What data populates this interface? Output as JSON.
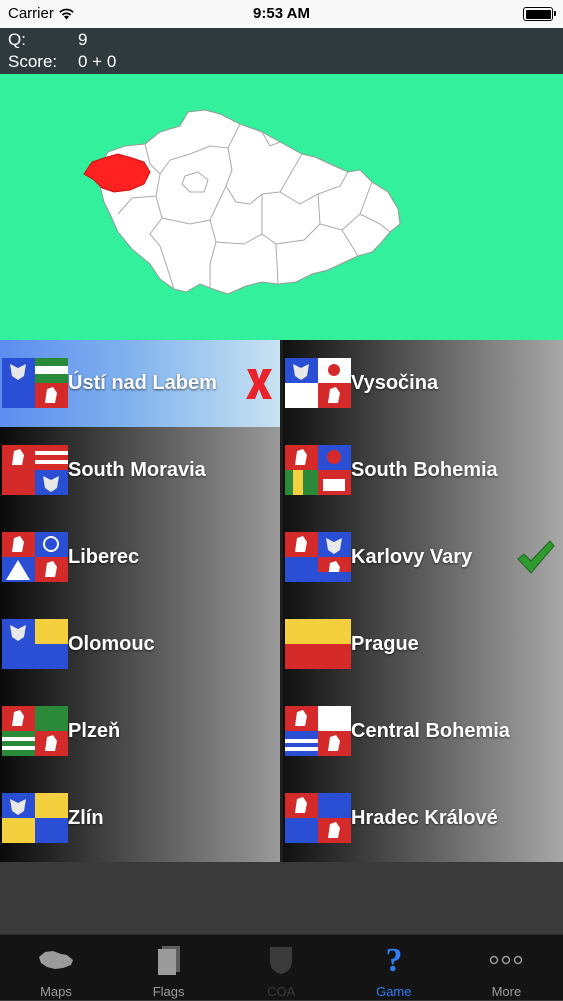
{
  "status": {
    "carrier": "Carrier",
    "time": "9:53 AM",
    "battery_level": 1.0
  },
  "header": {
    "q_label": "Q:",
    "q_value": "9",
    "score_label": "Score:",
    "score_value": "0 + 0"
  },
  "colors": {
    "map_background": "#33f09c",
    "highlight_region": "#ff2020",
    "tab_active": "#2f7ef6"
  },
  "answers": [
    {
      "label": "Ústí nad Labem",
      "state": "wrong",
      "mark_icon": "x-mark-icon"
    },
    {
      "label": "Vysočina",
      "state": "normal"
    },
    {
      "label": "South Moravia",
      "state": "normal"
    },
    {
      "label": "South Bohemia",
      "state": "normal"
    },
    {
      "label": "Liberec",
      "state": "normal"
    },
    {
      "label": "Karlovy Vary",
      "state": "correct",
      "mark_icon": "checkmark-icon"
    },
    {
      "label": "Olomouc",
      "state": "normal"
    },
    {
      "label": "Prague",
      "state": "normal"
    },
    {
      "label": "Plzeň",
      "state": "normal"
    },
    {
      "label": "Central Bohemia",
      "state": "normal"
    },
    {
      "label": "Zlín",
      "state": "normal"
    },
    {
      "label": "Hradec Králové",
      "state": "normal"
    }
  ],
  "tabs": [
    {
      "label": "Maps",
      "icon": "czech-map-icon",
      "state": "normal"
    },
    {
      "label": "Flags",
      "icon": "flags-icon",
      "state": "normal"
    },
    {
      "label": "COA",
      "icon": "coat-of-arms-icon",
      "state": "disabled"
    },
    {
      "label": "Game",
      "icon": "question-mark-icon",
      "state": "active"
    },
    {
      "label": "More",
      "icon": "more-dots-icon",
      "state": "normal"
    }
  ]
}
